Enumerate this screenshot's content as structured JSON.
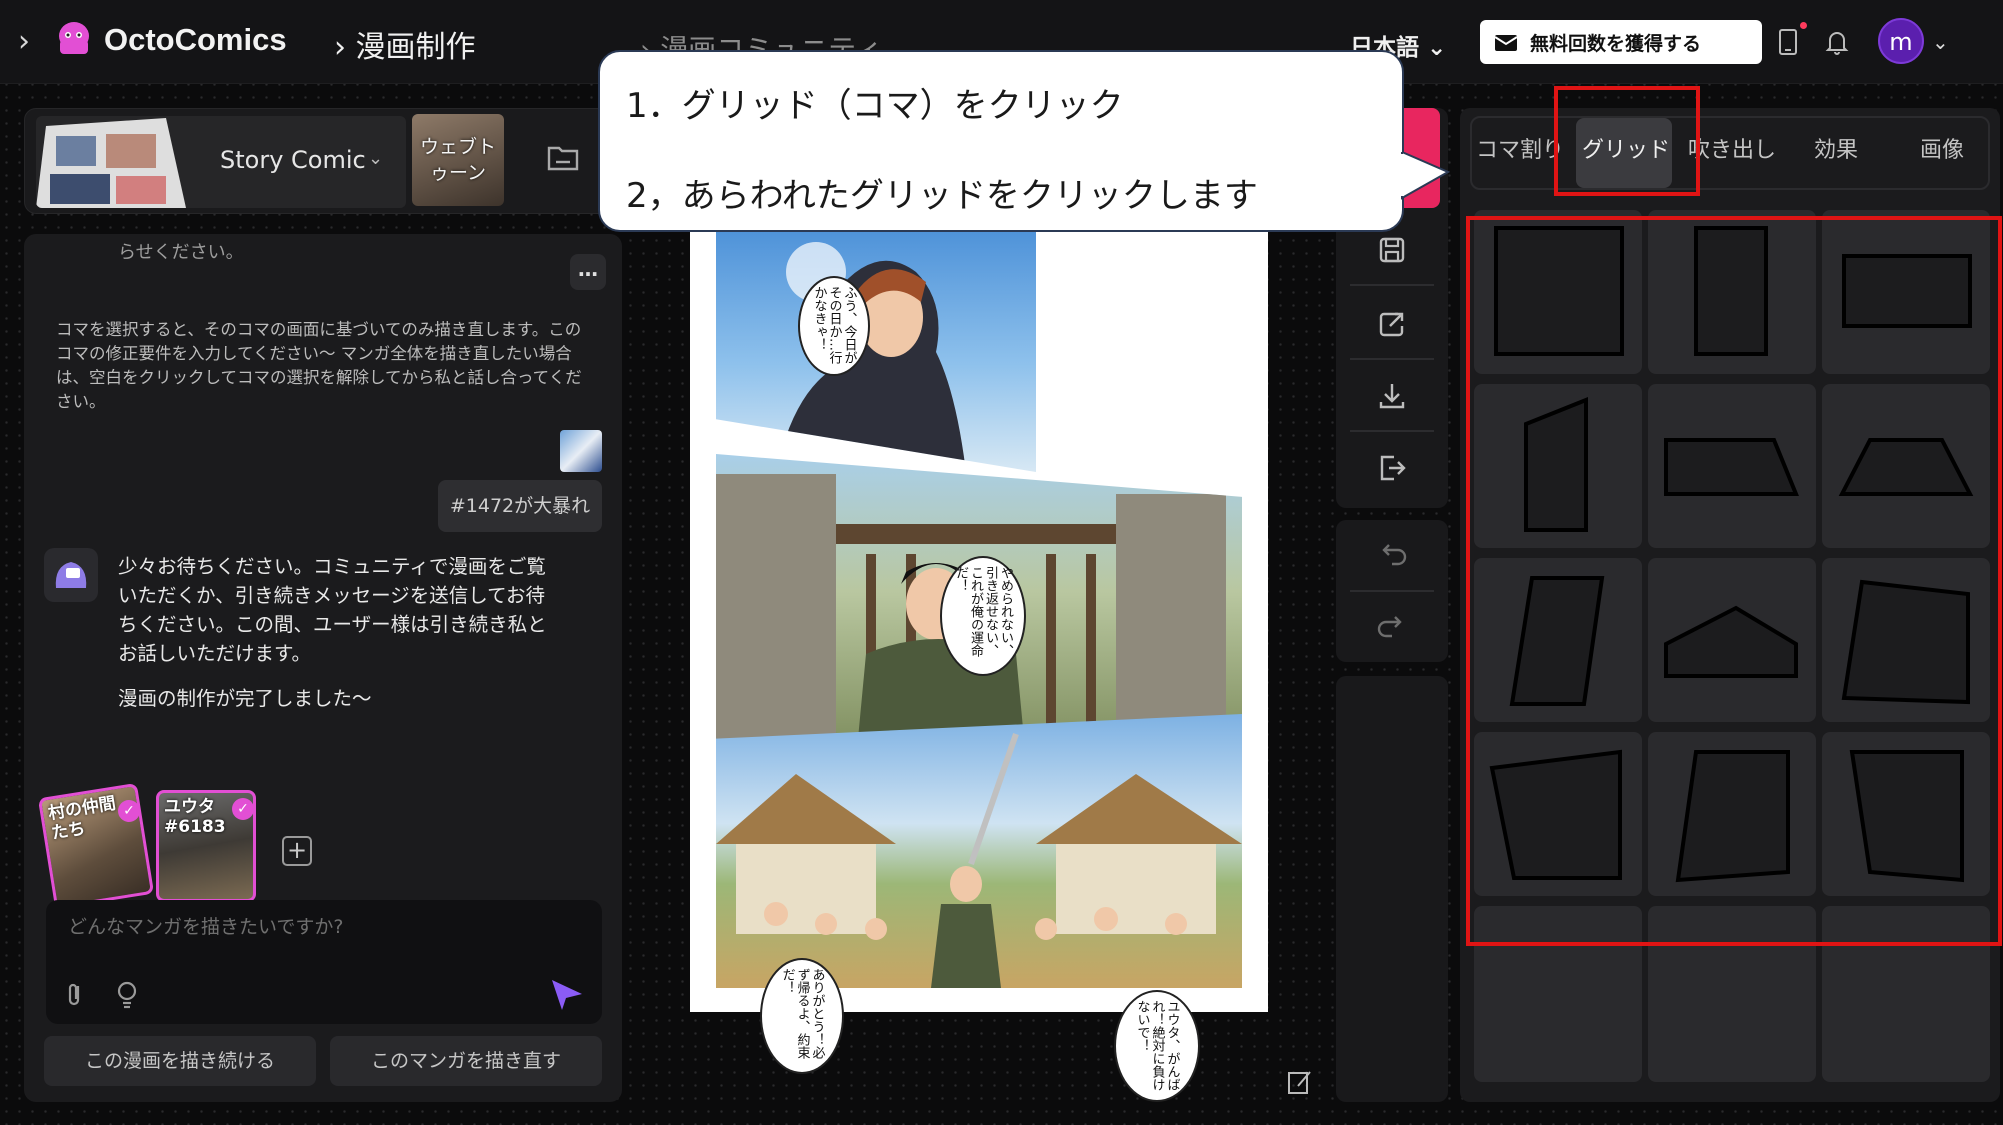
{
  "app": {
    "brand": "OctoComics",
    "breadcrumb_current": "漫画制作",
    "breadcrumb_next": "漫画コミュニティ",
    "language": "日本語",
    "get_free_button": "無料回数を獲得する",
    "avatar_letter": "m"
  },
  "top_panel": {
    "story_label": "Story Comic",
    "webtoon_label": "ウェブトゥーン"
  },
  "chat": {
    "cut_text": "らせください。",
    "system_message": "コマを選択すると、そのコマの画面に基づいてのみ描き直します。このコマの修正要件を入力してください～ マンガ全体を描き直したい場合は、空白をクリックしてコマの選択を解除してから私と話し合ってください。",
    "user_message": "#1472が大暴れ",
    "bot_message_1": "少々お待ちください。コミュニティで漫画をご覧いただくか、引き続きメッセージを送信してお待ちください。この間、ユーザー様は引き続き私とお話しいただけます。",
    "bot_message_2": "漫画の制作が完了しました～",
    "characters": [
      {
        "label": "村の仲間たち"
      },
      {
        "label": "ユウタ#6183"
      }
    ],
    "input_placeholder": "どんなマンガを描きたいですか?",
    "continue_button": "この漫画を描き続ける",
    "redraw_button": "このマンガを描き直す"
  },
  "comic": {
    "bubbles": [
      "ふう、今日がその日か…行かなきゃ！",
      "やめられない、引き返せない、これが俺の運命だ！",
      "ありがとう！必ず帰るよ、約束だ！",
      "ユウタ、がんばれ！絶対に負けないで！"
    ]
  },
  "right_panel": {
    "tabs": [
      "コマ割り",
      "グリッド",
      "吹き出し",
      "効果",
      "画像"
    ],
    "active_tab": "グリッド"
  },
  "annotation": {
    "line1": "1．グリッド（コマ）をクリック",
    "line2": "2，あらわれたグリッドをクリックします"
  },
  "colors": {
    "accent_pink": "#e8265f",
    "avatar_purple": "#5b1fae",
    "send_purple": "#8b5cf6",
    "highlight_red": "#e01414"
  }
}
